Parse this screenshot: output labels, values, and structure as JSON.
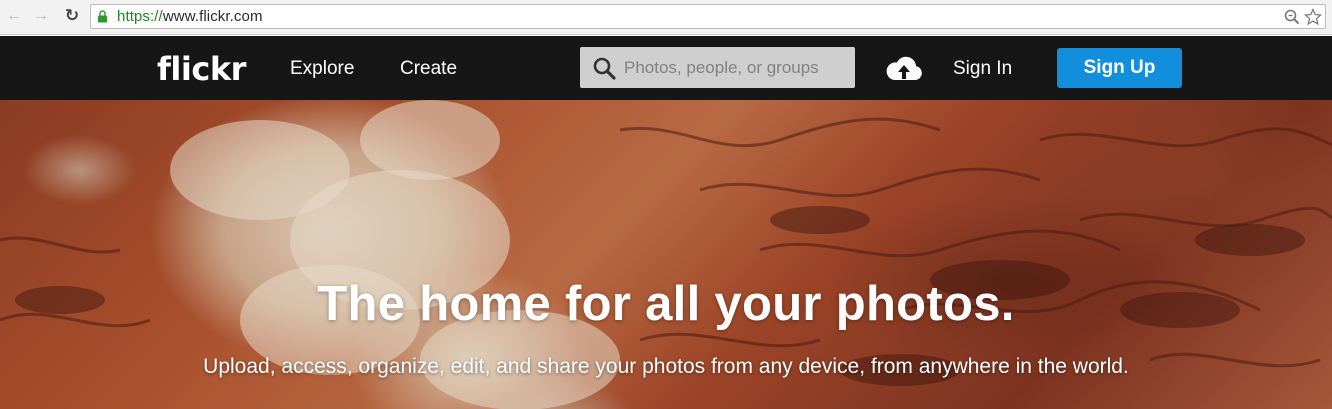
{
  "browser": {
    "url_scheme": "https://",
    "url_host": "www.flickr.com",
    "icons": [
      "back-arrow-icon",
      "forward-arrow-icon",
      "reload-icon",
      "lock-icon",
      "zoom-icon",
      "star-icon"
    ]
  },
  "header": {
    "logo": "flickr",
    "nav": {
      "explore": "Explore",
      "create": "Create"
    },
    "search": {
      "placeholder": "Photos, people, or groups",
      "value": ""
    },
    "upload_icon": "cloud-upload-icon",
    "sign_in": "Sign In",
    "sign_up": "Sign Up"
  },
  "hero": {
    "title": "The home for all your photos.",
    "subtitle": "Upload, access, organize, edit, and share your photos from any device, from anywhere in the world."
  },
  "colors": {
    "header_bg": "#161616",
    "signup_bg": "#128fdc",
    "search_bg": "#cfcfcf",
    "secure_green": "#1a8a1a"
  }
}
